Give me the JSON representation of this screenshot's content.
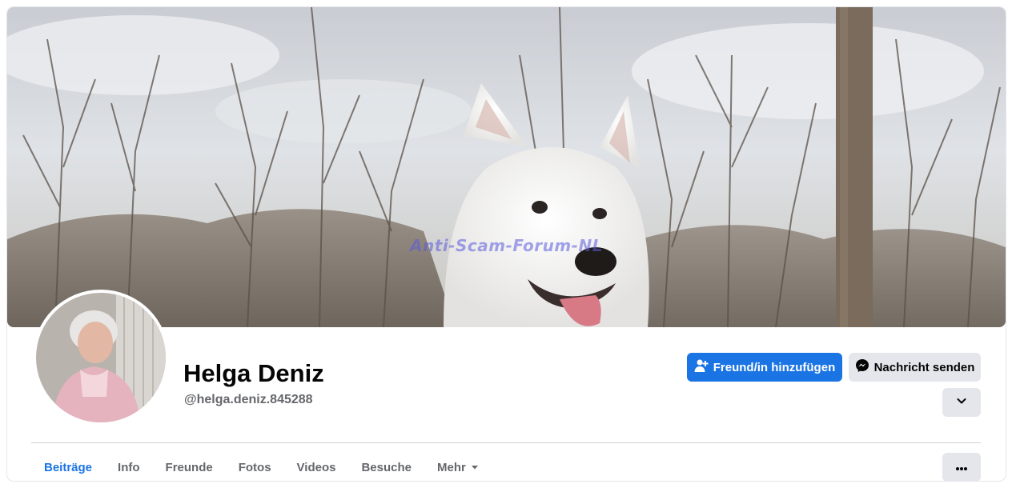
{
  "cover": {
    "watermark": "Anti-Scam-Forum-NL"
  },
  "profile": {
    "name": "Helga Deniz",
    "handle": "@helga.deniz.845288"
  },
  "actions": {
    "add_friend": "Freund/in hinzufügen",
    "send_message": "Nachricht senden"
  },
  "tabs": [
    {
      "label": "Beiträge",
      "active": true
    },
    {
      "label": "Info"
    },
    {
      "label": "Freunde"
    },
    {
      "label": "Fotos"
    },
    {
      "label": "Videos"
    },
    {
      "label": "Besuche"
    },
    {
      "label": "Mehr"
    }
  ],
  "colors": {
    "accent": "#1b74e4",
    "secondary_button": "#e4e6eb",
    "muted_text": "#65676b"
  },
  "icons": {
    "add_friend": "person-plus-icon",
    "message": "messenger-icon",
    "chevron": "chevron-down-icon",
    "more": "ellipsis-icon",
    "tab_more": "caret-down-icon"
  }
}
